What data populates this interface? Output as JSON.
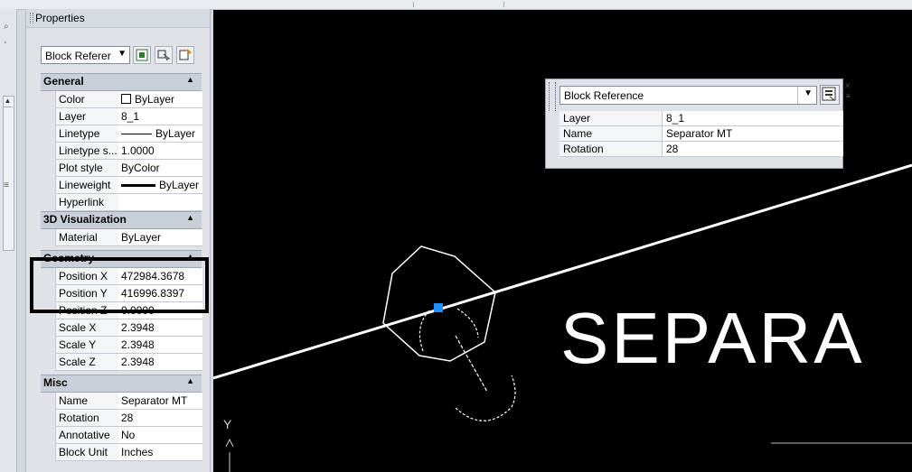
{
  "panel": {
    "title": "Properties",
    "object_type": "Block Referer",
    "sections": [
      {
        "name": "General",
        "rows": [
          {
            "key": "Color",
            "value": "ByLayer"
          },
          {
            "key": "Layer",
            "value": "8_1"
          },
          {
            "key": "Linetype",
            "value": "ByLayer"
          },
          {
            "key": "Linetype s...",
            "value": "1.0000"
          },
          {
            "key": "Plot style",
            "value": "ByColor"
          },
          {
            "key": "Lineweight",
            "value": "ByLayer"
          },
          {
            "key": "Hyperlink",
            "value": ""
          }
        ]
      },
      {
        "name": "3D Visualization",
        "rows": [
          {
            "key": "Material",
            "value": "ByLayer"
          }
        ]
      },
      {
        "name": "Geometry",
        "rows": [
          {
            "key": "Position X",
            "value": "472984.3678"
          },
          {
            "key": "Position Y",
            "value": "416996.8397"
          },
          {
            "key": "Position Z",
            "value": "0.0000"
          },
          {
            "key": "Scale X",
            "value": "2.3948"
          },
          {
            "key": "Scale Y",
            "value": "2.3948"
          },
          {
            "key": "Scale Z",
            "value": "2.3948"
          }
        ]
      },
      {
        "name": "Misc",
        "rows": [
          {
            "key": "Name",
            "value": "Separator MT"
          },
          {
            "key": "Rotation",
            "value": "28"
          },
          {
            "key": "Annotative",
            "value": "No"
          },
          {
            "key": "Block Unit",
            "value": "Inches"
          }
        ]
      }
    ]
  },
  "quick_properties": {
    "object_type": "Block Reference",
    "rows": [
      {
        "key": "Layer",
        "value": "8_1"
      },
      {
        "key": "Name",
        "value": "Separator MT"
      },
      {
        "key": "Rotation",
        "value": "28"
      }
    ]
  },
  "canvas": {
    "label_text": "SEPARA",
    "ucs_label": "Y",
    "grip_color": "#1e90ff"
  },
  "colors": {
    "canvas_bg": "#000000",
    "panel_bg": "#dfe3e8",
    "highlight_border": "#000000"
  }
}
